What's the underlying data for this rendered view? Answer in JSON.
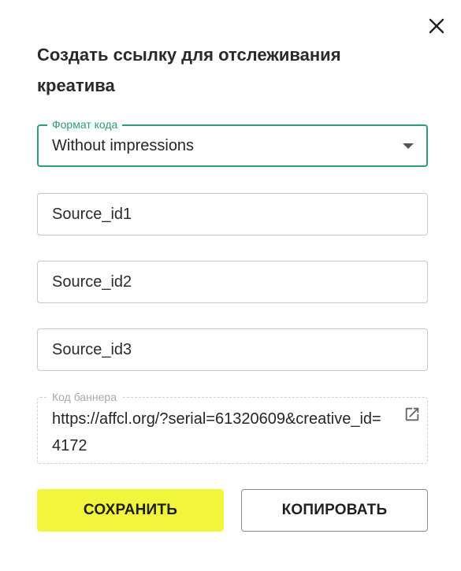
{
  "dialog": {
    "title": "Создать ссылку для отслеживания креатива",
    "close_icon": "close-icon"
  },
  "format_select": {
    "label": "Формат кода",
    "value": "Without impressions",
    "accent_color": "#2e9e74"
  },
  "source_fields": [
    {
      "value": "Source_id1"
    },
    {
      "value": "Source_id2"
    },
    {
      "value": "Source_id3"
    }
  ],
  "banner_code": {
    "label": "Код баннера",
    "value": "https://affcl.org/?serial=61320609&creative_id=4172",
    "open_icon": "open-in-new-icon"
  },
  "buttons": {
    "save_label": "СОХРАНИТЬ",
    "copy_label": "КОПИРОВАТЬ",
    "save_color": "#f1f53c"
  }
}
